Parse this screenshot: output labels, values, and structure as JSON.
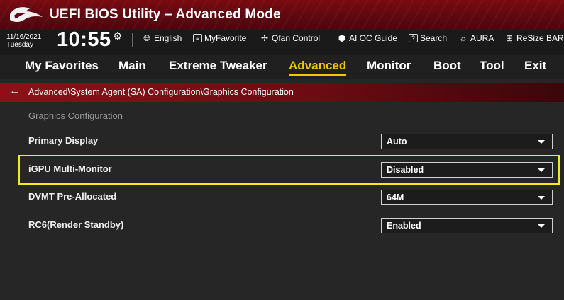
{
  "header": {
    "app_title": "UEFI BIOS Utility – Advanced Mode",
    "logo": "rog-logo"
  },
  "infobar": {
    "date": "11/16/2021",
    "weekday": "Tuesday",
    "time": "10:55",
    "settings_icon": "gear-icon",
    "tools": [
      {
        "label": "English",
        "icon": "globe-icon"
      },
      {
        "label": "MyFavorite",
        "icon": "favorite-icon"
      },
      {
        "label": "Qfan Control",
        "icon": "fan-icon"
      },
      {
        "label": "AI OC Guide",
        "icon": "ai-oc-icon"
      },
      {
        "label": "Search",
        "icon": "search-icon"
      },
      {
        "label": "AURA",
        "icon": "aura-icon"
      },
      {
        "label": "ReSize BAR",
        "icon": "resize-bar-icon"
      }
    ]
  },
  "tabs": [
    {
      "label": "My Favorites",
      "active": false
    },
    {
      "label": "Main",
      "active": false
    },
    {
      "label": "Extreme Tweaker",
      "active": false
    },
    {
      "label": "Advanced",
      "active": true
    },
    {
      "label": "Monitor",
      "active": false
    },
    {
      "label": "Boot",
      "active": false
    },
    {
      "label": "Tool",
      "active": false
    },
    {
      "label": "Exit",
      "active": false
    }
  ],
  "breadcrumb": {
    "path": "Advanced\\System Agent (SA) Configuration\\Graphics Configuration",
    "back_icon": "back-arrow-icon"
  },
  "content": {
    "section_title": "Graphics Configuration",
    "settings": [
      {
        "label": "Primary Display",
        "value": "Auto"
      },
      {
        "label": "iGPU Multi-Monitor",
        "value": "Disabled",
        "highlighted": true
      },
      {
        "label": "DVMT Pre-Allocated",
        "value": "64M"
      },
      {
        "label": "RC6(Render Standby)",
        "value": "Enabled"
      }
    ]
  },
  "colors": {
    "accent": "#f3c400",
    "brand_red": "#8d1018",
    "highlight_border": "#f2ea1c"
  }
}
